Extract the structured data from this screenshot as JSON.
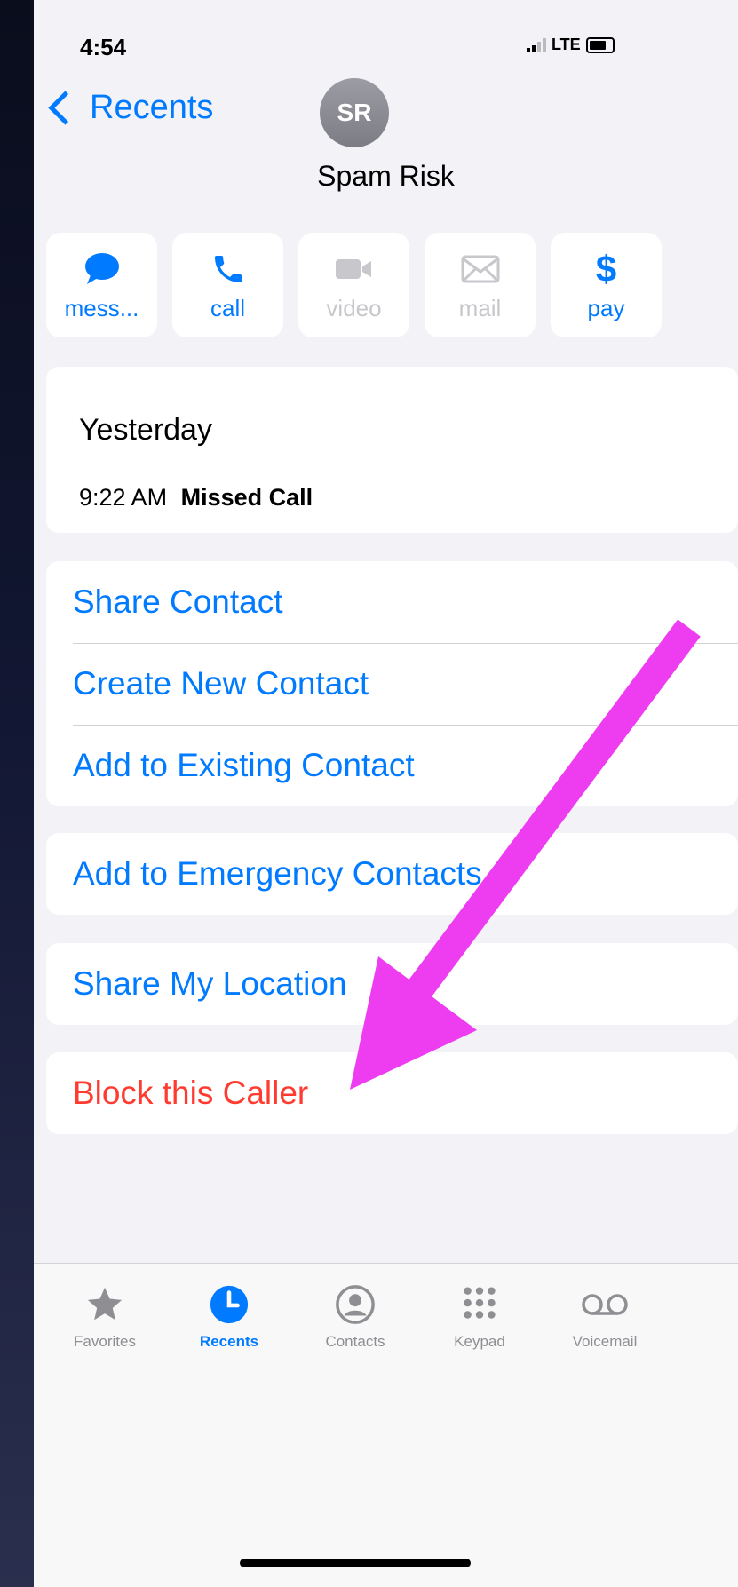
{
  "status_bar": {
    "time": "4:54",
    "network": "LTE"
  },
  "nav": {
    "back_label": "Recents"
  },
  "contact": {
    "initials": "SR",
    "name": "Spam Risk"
  },
  "actions": [
    {
      "label": "mess...",
      "icon": "message-icon",
      "enabled": true
    },
    {
      "label": "call",
      "icon": "phone-icon",
      "enabled": true
    },
    {
      "label": "video",
      "icon": "video-icon",
      "enabled": false
    },
    {
      "label": "mail",
      "icon": "mail-icon",
      "enabled": false
    },
    {
      "label": "pay",
      "icon": "dollar-icon",
      "enabled": true
    }
  ],
  "call_history": {
    "date": "Yesterday",
    "time": "9:22 AM",
    "status": "Missed Call"
  },
  "options": {
    "share_contact": "Share Contact",
    "create_new_contact": "Create New Contact",
    "add_to_existing_contact": "Add to Existing Contact",
    "add_to_emergency_contacts": "Add to Emergency Contacts",
    "share_my_location": "Share My Location",
    "block_this_caller": "Block this Caller"
  },
  "tab_bar": {
    "favorites": "Favorites",
    "recents": "Recents",
    "contacts": "Contacts",
    "keypad": "Keypad",
    "voicemail": "Voicemail",
    "active_tab": "Recents"
  },
  "colors": {
    "accent": "#007aff",
    "danger": "#ff3b30",
    "annotation_arrow": "#ee3df0"
  }
}
